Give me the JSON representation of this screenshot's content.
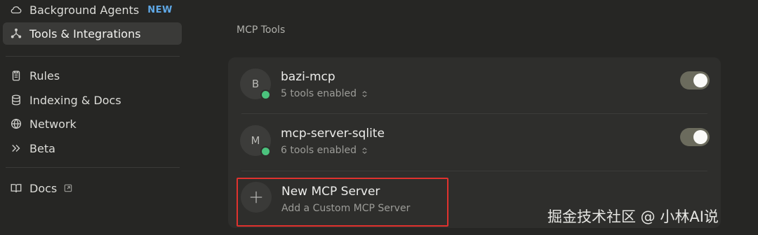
{
  "sidebar": {
    "items": [
      {
        "label": "Background Agents",
        "icon": "cloud-icon",
        "badge": "NEW"
      },
      {
        "label": "Tools & Integrations",
        "icon": "integrations-icon",
        "active": true
      },
      {
        "label": "Rules",
        "icon": "clipboard-icon"
      },
      {
        "label": "Indexing & Docs",
        "icon": "database-icon"
      },
      {
        "label": "Network",
        "icon": "globe-icon"
      },
      {
        "label": "Beta",
        "icon": "chevrons-right-icon"
      },
      {
        "label": "Docs",
        "icon": "book-icon",
        "external": true
      }
    ]
  },
  "main": {
    "section_title": "MCP Tools",
    "servers": [
      {
        "avatar": "B",
        "name": "bazi-mcp",
        "tools": "5 tools enabled",
        "enabled": true,
        "status": "green"
      },
      {
        "avatar": "M",
        "name": "mcp-server-sqlite",
        "tools": "6 tools enabled",
        "enabled": true,
        "status": "green"
      }
    ],
    "new_server": {
      "title": "New MCP Server",
      "subtitle": "Add a Custom MCP Server"
    }
  },
  "watermark": "掘金技术社区 @ 小林AI说",
  "colors": {
    "background": "#262624",
    "card": "#2e2e2c",
    "status_green": "#4bc27d",
    "toggle_on": "#6b6b5d",
    "highlight_red": "#e0322e",
    "badge_blue": "#5fa8e6"
  }
}
